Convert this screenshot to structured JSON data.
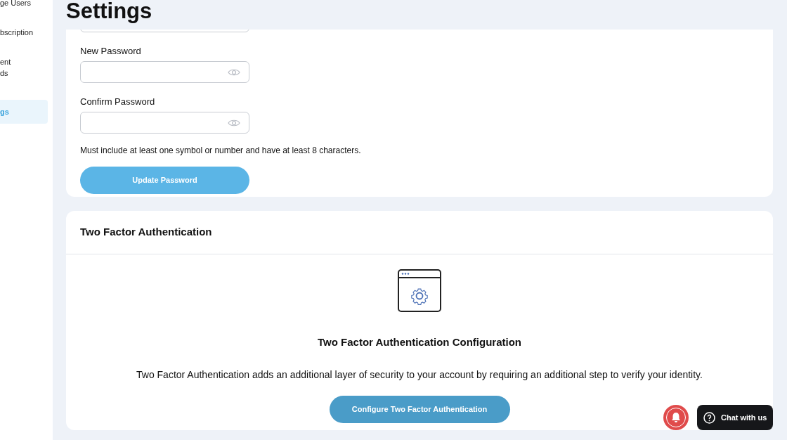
{
  "sidebar": {
    "items": [
      {
        "label": "ge Users",
        "selected": false
      },
      {
        "label": "bscription",
        "selected": false
      },
      {
        "label": "ent\nds",
        "selected": false
      },
      {
        "label": "gs",
        "selected": true
      }
    ]
  },
  "page_title": "Settings",
  "password_card": {
    "fields": [
      {
        "label": "New Password"
      },
      {
        "label": "Confirm Password"
      }
    ],
    "hint": "Must include at least one symbol or number and have at least 8 characters.",
    "button": "Update Password"
  },
  "two_factor_card": {
    "title": "Two Factor Authentication",
    "heading": "Two Factor Authentication Configuration",
    "description": "Two Factor Authentication adds an additional layer of security to your account by requiring an additional step to verify your identity.",
    "button": "Configure Two Factor Authentication"
  },
  "chat_button": "Chat with us"
}
